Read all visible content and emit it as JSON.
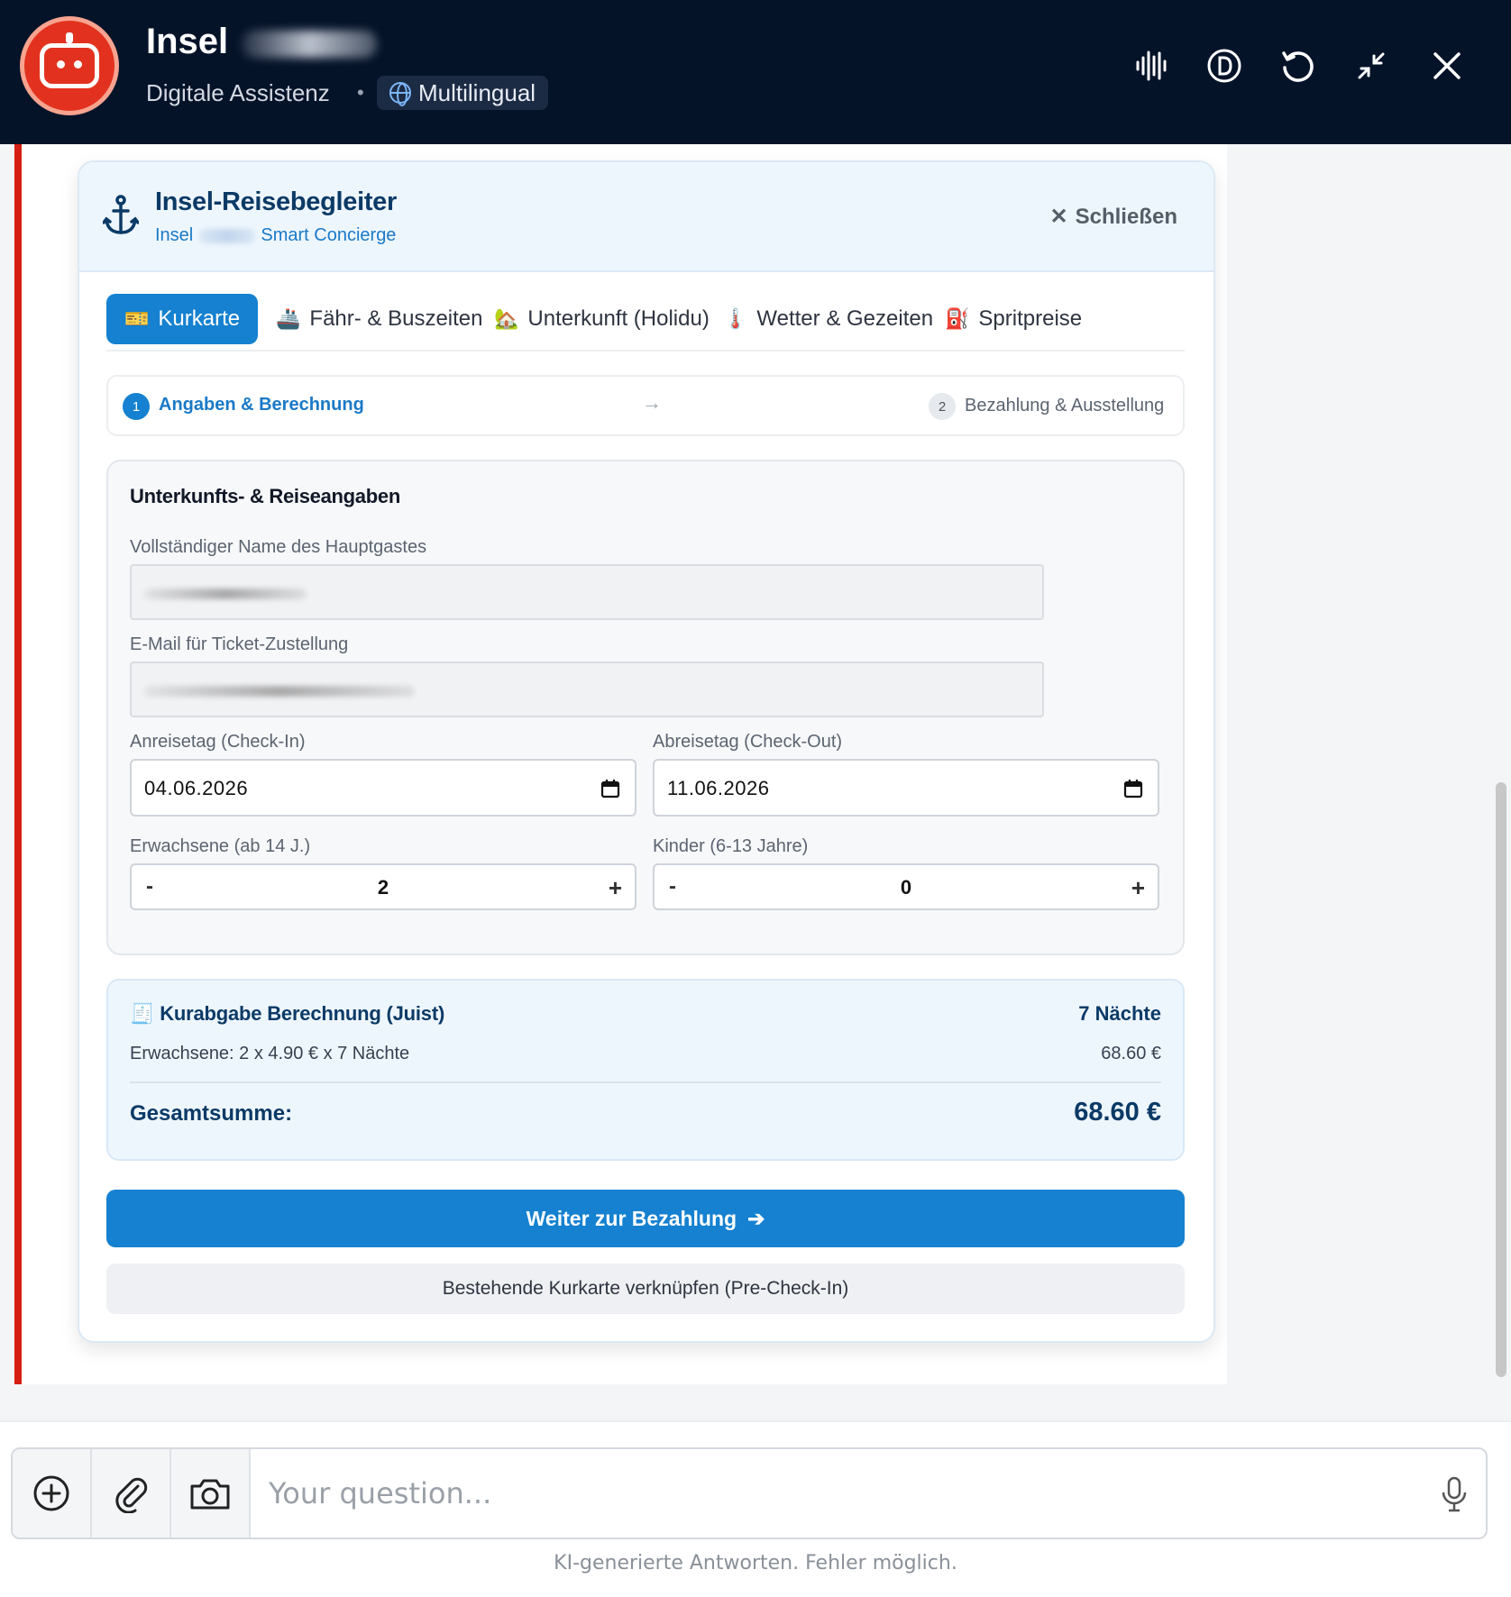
{
  "header": {
    "title": "Insel",
    "subtitle": "Digitale Assistenz",
    "separator": "•",
    "language_badge": "Multilingual",
    "icons": [
      "waveform-icon",
      "d-circle-icon",
      "refresh-icon",
      "minimize-icon",
      "close-icon"
    ]
  },
  "card": {
    "title": "Insel-Reisebegleiter",
    "subtitle_prefix": "Insel",
    "subtitle_suffix": "Smart Concierge",
    "close_label": "Schließen",
    "close_glyph": "✕"
  },
  "tabs": [
    {
      "icon": "🎫",
      "label": "Kurkarte",
      "active": true
    },
    {
      "icon": "🚢",
      "label": "Fähr- & Buszeiten",
      "active": false
    },
    {
      "icon": "🏡",
      "label": "Unterkunft (Holidu)",
      "active": false
    },
    {
      "icon": "🌡️",
      "label": "Wetter & Gezeiten",
      "active": false
    },
    {
      "icon": "⛽",
      "label": "Spritpreise",
      "active": false
    }
  ],
  "steps": {
    "step1_num": "1",
    "step1_label": "Angaben & Berechnung",
    "arrow": "→",
    "step2_num": "2",
    "step2_label": "Bezahlung & Ausstellung"
  },
  "form": {
    "title": "Unterkunfts- & Reiseangaben",
    "name_label": "Vollständiger Name des Hauptgastes",
    "email_label": "E-Mail für Ticket-Zustellung",
    "checkin_label": "Anreisetag (Check-In)",
    "checkin_value": "04.06.2026",
    "checkout_label": "Abreisetag (Check-Out)",
    "checkout_value": "11.06.2026",
    "adults_label": "Erwachsene (ab 14 J.)",
    "adults_value": "2",
    "children_label": "Kinder (6-13 Jahre)",
    "children_value": "0",
    "minus": "-",
    "plus": "+"
  },
  "calc": {
    "icon": "🧾",
    "title": "Kurabgabe Berechnung (Juist)",
    "nights": "7 Nächte",
    "line_label": "Erwachsene: 2 x 4.90 € x 7 Nächte",
    "line_amount": "68.60 €",
    "total_label": "Gesamtsumme:",
    "total_amount": "68.60 €"
  },
  "actions": {
    "primary_label": "Weiter zur Bezahlung",
    "primary_arrow": "➔",
    "secondary_label": "Bestehende Kurkarte verknüpfen (Pre-Check-In)"
  },
  "input": {
    "placeholder": "Your question..."
  },
  "footer": "KI-generierte Antworten. Fehler möglich."
}
